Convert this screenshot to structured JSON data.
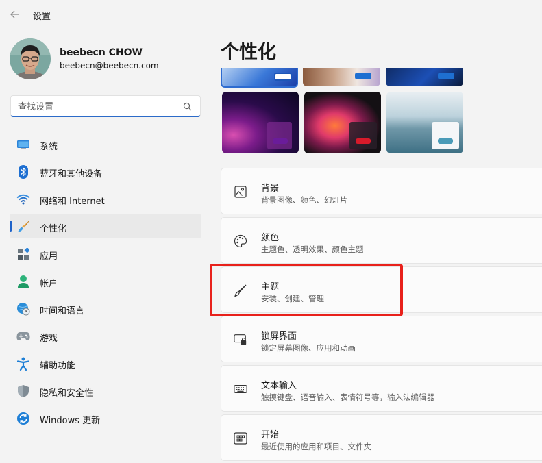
{
  "window": {
    "title": "设置"
  },
  "profile": {
    "name": "beebecn CHOW",
    "email": "beebecn@beebecn.com"
  },
  "search": {
    "placeholder": "查找设置"
  },
  "nav": {
    "items": [
      {
        "label": "系统",
        "icon": "monitor-icon"
      },
      {
        "label": "蓝牙和其他设备",
        "icon": "bluetooth-icon"
      },
      {
        "label": "网络和 Internet",
        "icon": "wifi-icon"
      },
      {
        "label": "个性化",
        "icon": "brush-icon",
        "active": true
      },
      {
        "label": "应用",
        "icon": "apps-icon"
      },
      {
        "label": "帐户",
        "icon": "person-icon"
      },
      {
        "label": "时间和语言",
        "icon": "globe-clock-icon"
      },
      {
        "label": "游戏",
        "icon": "gamepad-icon"
      },
      {
        "label": "辅助功能",
        "icon": "accessibility-icon"
      },
      {
        "label": "隐私和安全性",
        "icon": "shield-icon"
      },
      {
        "label": "Windows 更新",
        "icon": "update-icon"
      }
    ]
  },
  "main": {
    "title": "个性化",
    "settings": [
      {
        "title": "背景",
        "subtitle": "背景图像、颜色、幻灯片",
        "icon": "image-icon"
      },
      {
        "title": "颜色",
        "subtitle": "主题色、透明效果、颜色主题",
        "icon": "palette-icon"
      },
      {
        "title": "主题",
        "subtitle": "安装、创建、管理",
        "icon": "brush-icon"
      },
      {
        "title": "锁屏界面",
        "subtitle": "锁定屏幕图像、应用和动画",
        "icon": "lock-screen-icon"
      },
      {
        "title": "文本输入",
        "subtitle": "触摸键盘、语音输入、表情符号等，输入法编辑器",
        "icon": "keyboard-icon"
      },
      {
        "title": "开始",
        "subtitle": "最近使用的应用和项目、文件夹",
        "icon": "start-icon"
      }
    ]
  },
  "colors": {
    "accent": "#1f63c9",
    "highlight": "#e8211b"
  }
}
